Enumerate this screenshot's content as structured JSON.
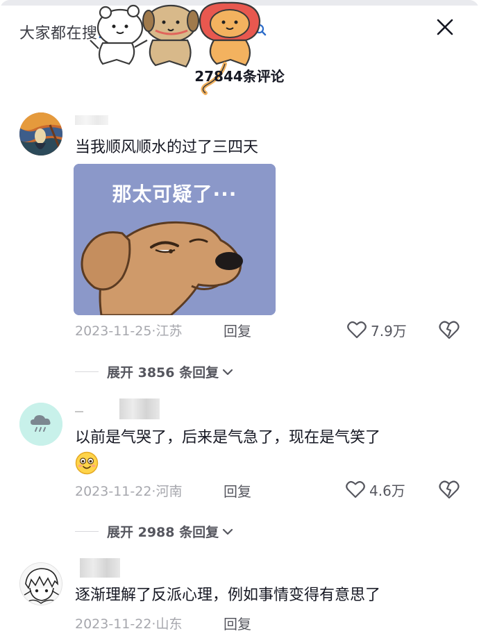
{
  "header": {
    "search_hint": "大家都在搜",
    "search_hint_tail": "...",
    "comment_count": "27844条评论"
  },
  "comments": [
    {
      "text": "当我顺风顺水的过了三四天",
      "image_caption": "那太可疑了···",
      "date_location": "2023-11-25·江苏",
      "reply_label": "回复",
      "likes": "7.9万",
      "expand_label": "展开 3856 条回复"
    },
    {
      "text": "以前是气哭了，后来是气急了，现在是气笑了",
      "date_location": "2023-11-22·河南",
      "reply_label": "回复",
      "likes": "4.6万",
      "expand_label": "展开 2988 条回复"
    },
    {
      "text": "逐渐理解了反派心理，例如事情变得有意思了",
      "date_location": "2023-11-22·山东",
      "reply_label": "回复"
    }
  ],
  "icons": {
    "close": "close-icon",
    "search": "search-icon",
    "like": "heart-outline-icon",
    "dislike": "broken-heart-icon",
    "expand": "chevron-down-icon",
    "emoji": "smiling-face-emoji"
  },
  "colors": {
    "text_primary": "#161823",
    "text_meta": "#a6a7ad",
    "meme_background": "#8b98c9",
    "avatar2_background": "#c8f1ea"
  }
}
